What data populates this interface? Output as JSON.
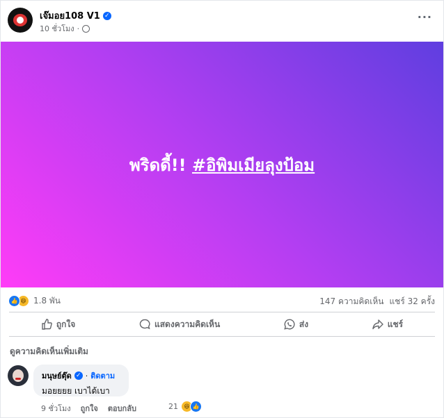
{
  "post": {
    "author": "เจ๊มอย108 V1",
    "time": "10 ชั่วโมง",
    "time_separator": "·",
    "banner_text": "พริดดี้!!",
    "banner_hashtag": "#อิพิมเมียลุงป้อม"
  },
  "stats": {
    "reaction_count": "1.8 พัน",
    "comments": "147 ความคิดเห็น",
    "shares": "แชร์ 32 ครั้ง"
  },
  "actions": {
    "like": "ถูกใจ",
    "comment": "แสดงความคิดเห็น",
    "send": "ส่ง",
    "share": "แชร์"
  },
  "comments_section": {
    "more_label": "ดูความคิดเห็นเพิ่มเติม",
    "comment": {
      "name": "มนุษย์ตุ๊ด",
      "separator": "·",
      "follow": "ติดตาม",
      "text": "มอยยยย เบาได้เบา",
      "time": "9 ชั่วโมง",
      "like": "ถูกใจ",
      "reply": "ตอบกลับ",
      "reaction_count": "21"
    }
  },
  "colors": {
    "accent": "#0866ff",
    "like_blue": "#1877f2",
    "haha_yellow": "#f7b928",
    "banner_start": "#ff3cf7",
    "banner_end": "#5f3ee0"
  }
}
